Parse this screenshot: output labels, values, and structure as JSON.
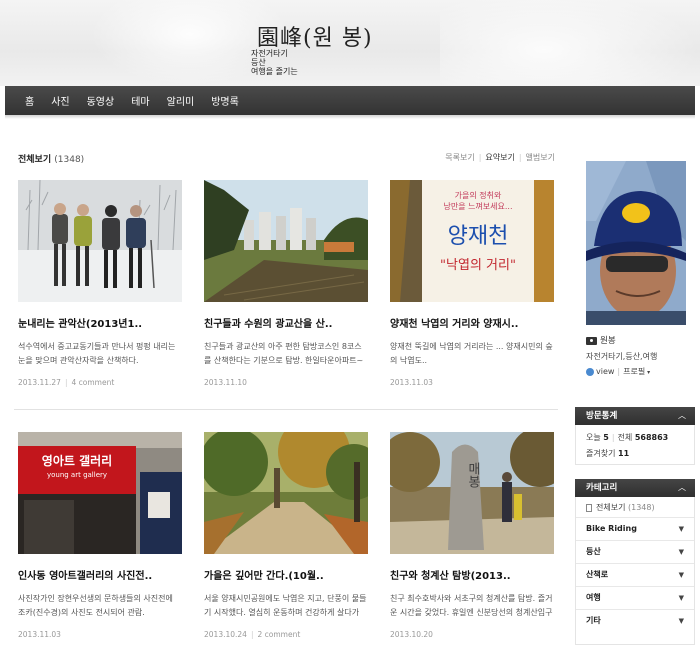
{
  "header": {
    "title": "園峰(원 봉)",
    "desc_lines": [
      "자전거타기",
      "등산",
      "여행을 즐기는"
    ]
  },
  "nav": {
    "items": [
      "홈",
      "사진",
      "동영상",
      "테마",
      "알리미",
      "방명록"
    ]
  },
  "main": {
    "title": "전체보기",
    "count": "(1348)",
    "views": [
      "목록보기",
      "요약보기",
      "앨범보기"
    ]
  },
  "posts": [
    {
      "title": "눈내리는 관악산(2013년1..",
      "excerpt": "석수역에서 중고교동기들과 만나서 펑펑 내리는 눈을 맞으며 관악산자락을 산책하다.",
      "date": "2013.11.27",
      "comment": "4 comment"
    },
    {
      "title": "친구들과 수원의 광교산을 산..",
      "excerpt": "친구들과 광교산의 아주 편한 탐방코스인 8코스를 산책한다는 기분으로 탐방. 한일타운아파트~광교헬기..",
      "date": "2013.11.10",
      "comment": ""
    },
    {
      "title": "양재천 낙엽의 거리와 양재시..",
      "excerpt": "양재천 뚝길에 낙엽의 거리라는 ... 양재시민의 숲의 낙엽도..",
      "date": "2013.11.03",
      "comment": ""
    },
    {
      "title": "인사동 영아트갤러리의 사진전..",
      "excerpt": "사진작가인 장현우선생의 문하생들의 사진전에 조카(진수경)의 사진도 전시되어 관람.",
      "date": "2013.11.03",
      "comment": ""
    },
    {
      "title": "가을은 깊어만 간다.(10월..",
      "excerpt": "서울 양재시민공원에도 낙엽은 지고, 단풍이 물들기 시작했다. 열심히 운동하며 건강하게 살다가 슬며..",
      "date": "2013.10.24",
      "comment": "2 comment"
    },
    {
      "title": "친구와 청계산 탐방(2013..",
      "excerpt": "친구 최수호박사와 서초구의 청계산를 탐방. 즐거운 시간을 갖었다. 휴일엔 신분당선의 청계산입구역을..",
      "date": "2013.10.20",
      "comment": ""
    }
  ],
  "thumb_text": {
    "sign_top": "가을의 정취와\n낭만을 느껴보세요...",
    "sign_main": "양재천",
    "sign_sub": "\"낙엽의 거리\"",
    "gallery_ko": "영아트 갤러리",
    "gallery_en": "young art gallery",
    "stone": "매봉"
  },
  "sidebar": {
    "profile_name": "원봉",
    "profile_tags": "자전거타기,등산,여행",
    "profile_links": [
      "view",
      "프로필"
    ],
    "stats": {
      "head": "방문통계",
      "today_label": "오늘",
      "today": "5",
      "total_label": "전체",
      "total": "568863",
      "fav_label": "즐겨찾기",
      "fav": "11"
    },
    "category": {
      "head": "카테고리",
      "all_label": "전체보기",
      "all_count": "(1348)",
      "items": [
        "Bike Riding",
        "등산",
        "산책로",
        "여행",
        "기타"
      ]
    }
  },
  "colors": {
    "nav_bg": "#3a3a3a",
    "widget_head": "#333333"
  }
}
